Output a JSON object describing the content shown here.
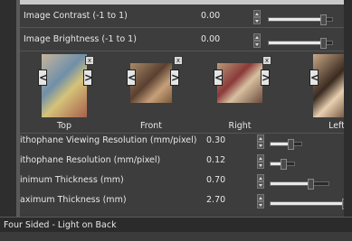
{
  "settings": {
    "contrast": {
      "label": "Image Contrast (-1 to 1)",
      "value": "0.00",
      "level": 0.55
    },
    "brightness": {
      "label": "Image Brightness (-1 to 1)",
      "value": "0.00",
      "level": 0.55
    },
    "viewing_res": {
      "label": "ithophane Viewing Resolution (mm/pixel)",
      "value": "0.30",
      "level": 0.6
    },
    "res": {
      "label": "ithophane Resolution (mm/pixel)",
      "value": "0.12",
      "level": 0.45
    },
    "min_thick": {
      "label": "inimum Thickness (mm)",
      "value": "0.70",
      "level": 0.8
    },
    "max_thick": {
      "label": "aximum Thickness (mm)",
      "value": "2.70",
      "level": 0.97
    }
  },
  "images": [
    {
      "caption": "Top",
      "x_label": "x",
      "prev": "<",
      "next": ">"
    },
    {
      "caption": "Front",
      "x_label": "x",
      "prev": "<",
      "next": ">"
    },
    {
      "caption": "Right",
      "x_label": "x",
      "prev": "<",
      "next": ">"
    },
    {
      "caption": "Left",
      "x_label": "x",
      "prev": "<",
      "next": ">"
    }
  ],
  "mode_bar": {
    "label": "Four Sided - Light on Back"
  }
}
